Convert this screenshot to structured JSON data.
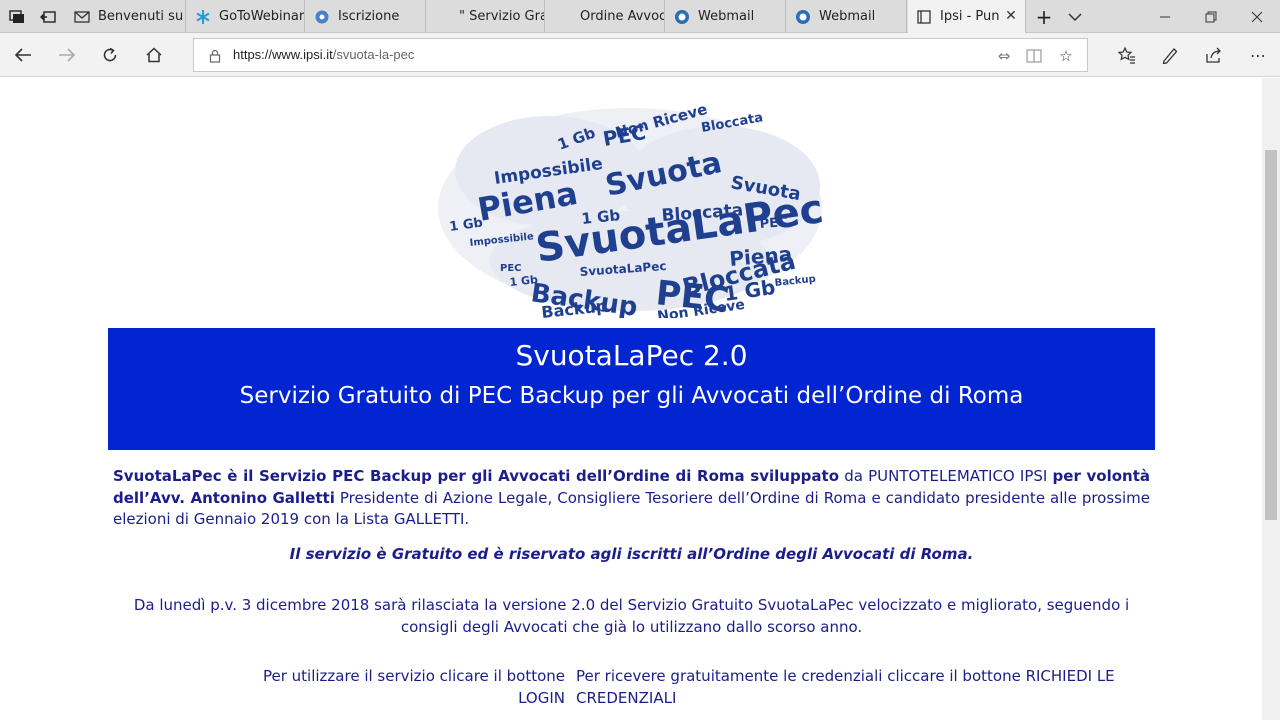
{
  "browser": {
    "tabs": [
      {
        "label": "Benvenuti su",
        "active": false
      },
      {
        "label": "GoToWebinar",
        "active": false
      },
      {
        "label": "Iscrizione",
        "active": false
      },
      {
        "label": "\" Servizio Gra",
        "active": false
      },
      {
        "label": "Ordine Avvoc",
        "active": false
      },
      {
        "label": "Webmail",
        "active": false
      },
      {
        "label": "Webmail",
        "active": false
      },
      {
        "label": "Ipsi - Pun",
        "active": true
      }
    ],
    "address": {
      "host": "https://www.ipsi.it",
      "path": "/svuota-la-pec"
    }
  },
  "page": {
    "banner": {
      "title": "SvuotaLaPec 2.0",
      "subtitle": "Servizio Gratuito di PEC Backup per gli Avvocati dell’Ordine di Roma"
    },
    "intro": {
      "bold1": "SvuotaLaPec è il Servizio PEC Backup per gli Avvocati dell’Ordine di Roma sviluppato",
      "plain1": " da PUNTOTELEMATICO IPSI ",
      "bold2": "per volontà dell’Avv. Antonino Galletti",
      "plain2": " Presidente di Azione Legale, Consigliere Tesoriere dell’Ordine di Roma e candidato presidente alle prossime elezioni di Gennaio 2019 con la Lista GALLETTI."
    },
    "free_notice": "Il servizio è Gratuito ed è riservato agli iscritti all’Ordine degli Avvocati di Roma.",
    "announcement": "Da lunedì p.v. 3 dicembre 2018 sarà rilasciata la versione 2.0 del Servizio Gratuito SvuotaLaPec velocizzato e migliorato, seguendo i consigli degli Avvocati che già lo utilizzano dallo scorso anno.",
    "login_instruction": "Per utilizzare il servizio clicare il bottone LOGIN",
    "credentials_instruction": "Per ricevere gratuitamente le credenziali  cliccare il bottone RICHIEDI LE CREDENZIALI"
  },
  "colors": {
    "banner_bg": "#0025d1",
    "text": "#1b1e8a",
    "cloud": "#1f3f8f"
  }
}
